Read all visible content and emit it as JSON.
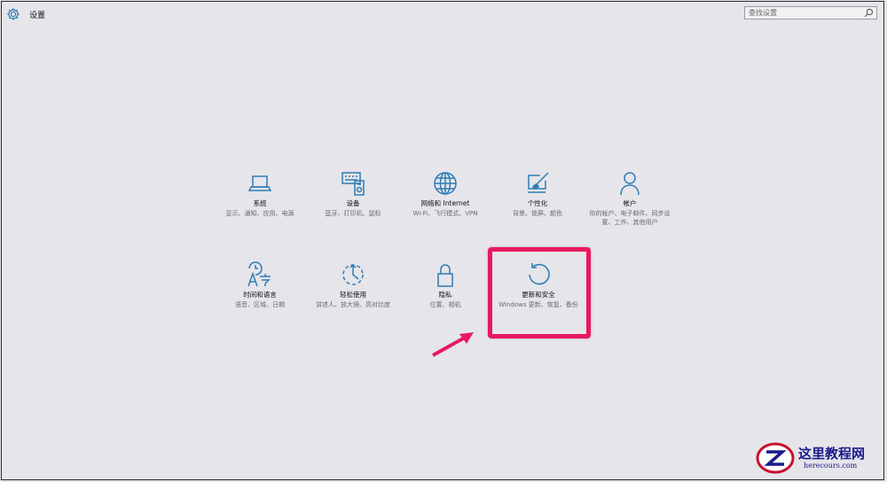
{
  "window": {
    "title": "设置"
  },
  "search": {
    "placeholder": "查找设置"
  },
  "tiles": [
    {
      "label": "系统",
      "desc": "显示、通知、应用、电源",
      "icon": "laptop-icon"
    },
    {
      "label": "设备",
      "desc": "蓝牙、打印机、鼠标",
      "icon": "keyboard-printer-icon"
    },
    {
      "label": "网络和 Internet",
      "desc": "Wi-Fi、飞行模式、VPN",
      "icon": "globe-icon"
    },
    {
      "label": "个性化",
      "desc": "背景、锁屏、颜色",
      "icon": "paint-brush-icon"
    },
    {
      "label": "帐户",
      "desc": "你的帐户、电子邮件、同步设置、工作、其他用户",
      "icon": "person-icon"
    },
    {
      "label": "时间和语言",
      "desc": "语音、区域、日期",
      "icon": "time-language-icon"
    },
    {
      "label": "轻松使用",
      "desc": "讲述人、放大镜、高对比度",
      "icon": "ease-of-access-icon"
    },
    {
      "label": "隐私",
      "desc": "位置、相机",
      "icon": "lock-icon"
    },
    {
      "label": "更新和安全",
      "desc": "Windows 更新、恢复、备份",
      "icon": "refresh-icon"
    }
  ],
  "annotation": {
    "highlighted_tile": "更新和安全",
    "highlight_color": "#e8195f"
  },
  "watermark": {
    "cn": "这里教程网",
    "en": "herecours.com"
  },
  "colors": {
    "accent": "#2e7db5",
    "background": "#e6e5ea"
  }
}
